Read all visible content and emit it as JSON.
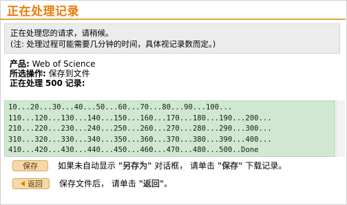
{
  "header": {
    "title": "正在处理记录"
  },
  "notice": {
    "line1": "正在处理您的请求，请稍候。",
    "line2": "(注: 处理过程可能需要几分钟的时间，具体视记录数而定。)"
  },
  "info": {
    "product_label": "产品:",
    "product_value": "Web of Science",
    "operation_label": "所选操作:",
    "operation_value": "保存到文件",
    "processing_label": "正在处理",
    "processing_count": "500",
    "processing_unit": "记录:"
  },
  "progress": {
    "lines": [
      "10...20...30...40...50...60...70...80...90...100...",
      "110...120...130...140...150...160...170...180...190...200...",
      "210...220...230...240...250...260...270...280...290...300...",
      "310...320...330...340...350...360...370...380...390...400...",
      "410...420...430...440...450...460...470...480...500..Done"
    ]
  },
  "actions": {
    "save_button": "保存",
    "save_text_prefix": "如果未自动显示",
    "save_text_quote1": "\"另存为\"",
    "save_text_middle": "对话框，  请单击",
    "save_text_quote2": "\"保存\"",
    "save_text_suffix": "下载记录。",
    "back_button": "返回",
    "back_text_prefix": "保存文件后，  请单击",
    "back_text_quote": "\"返回\"",
    "back_text_suffix": "。"
  },
  "colors": {
    "title": "#e87a0c",
    "title_rule": "#e8a13a",
    "progress_bg": "#cfe8cf",
    "button_bg": "#f7d9a8"
  },
  "icons": {
    "back": "left-arrow-icon"
  }
}
